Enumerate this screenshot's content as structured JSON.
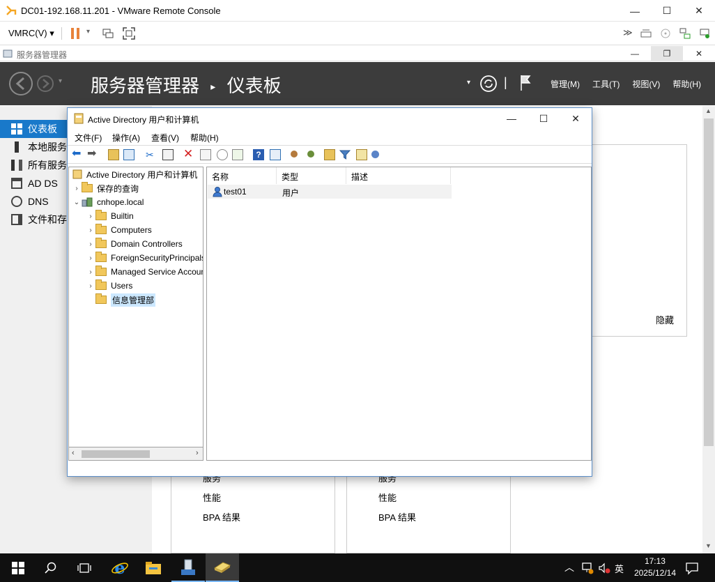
{
  "vmrc": {
    "title": "DC01-192.168.11.201 - VMware Remote Console",
    "menu_label": "VMRC(V)",
    "send_keys_icon": "send-ctrl-alt-del-icon",
    "fullscreen_icon": "fullscreen-icon"
  },
  "server_manager": {
    "window_title": "服务器管理器",
    "breadcrumb": {
      "app": "服务器管理器",
      "page": "仪表板"
    },
    "menus": [
      "管理(M)",
      "工具(T)",
      "视图(V)",
      "帮助(H)"
    ],
    "nav": [
      "仪表板",
      "本地服务",
      "所有服务",
      "AD DS",
      "DNS",
      "文件和存"
    ],
    "hide_label": "隐藏",
    "tile_left": {
      "top_partial": "服务",
      "perf": "性能",
      "bpa": "BPA 结果"
    },
    "tile_right": {
      "top_partial": "服务",
      "perf": "性能",
      "bpa": "BPA 结果"
    }
  },
  "aduc": {
    "title": "Active Directory 用户和计算机",
    "menubar": [
      "文件(F)",
      "操作(A)",
      "查看(V)",
      "帮助(H)"
    ],
    "tree": {
      "root": "Active Directory 用户和计算机",
      "saved_queries": "保存的查询",
      "domain": "cnhope.local",
      "children": [
        "Builtin",
        "Computers",
        "Domain Controllers",
        "ForeignSecurityPrincipals",
        "Managed Service Accounts",
        "Users",
        "信息管理部"
      ]
    },
    "columns": [
      "名称",
      "类型",
      "描述"
    ],
    "rows": [
      {
        "name": "test01",
        "type": "用户",
        "desc": ""
      }
    ]
  },
  "taskbar": {
    "ime": "英",
    "time": "17:13",
    "date": "2025/12/14"
  }
}
